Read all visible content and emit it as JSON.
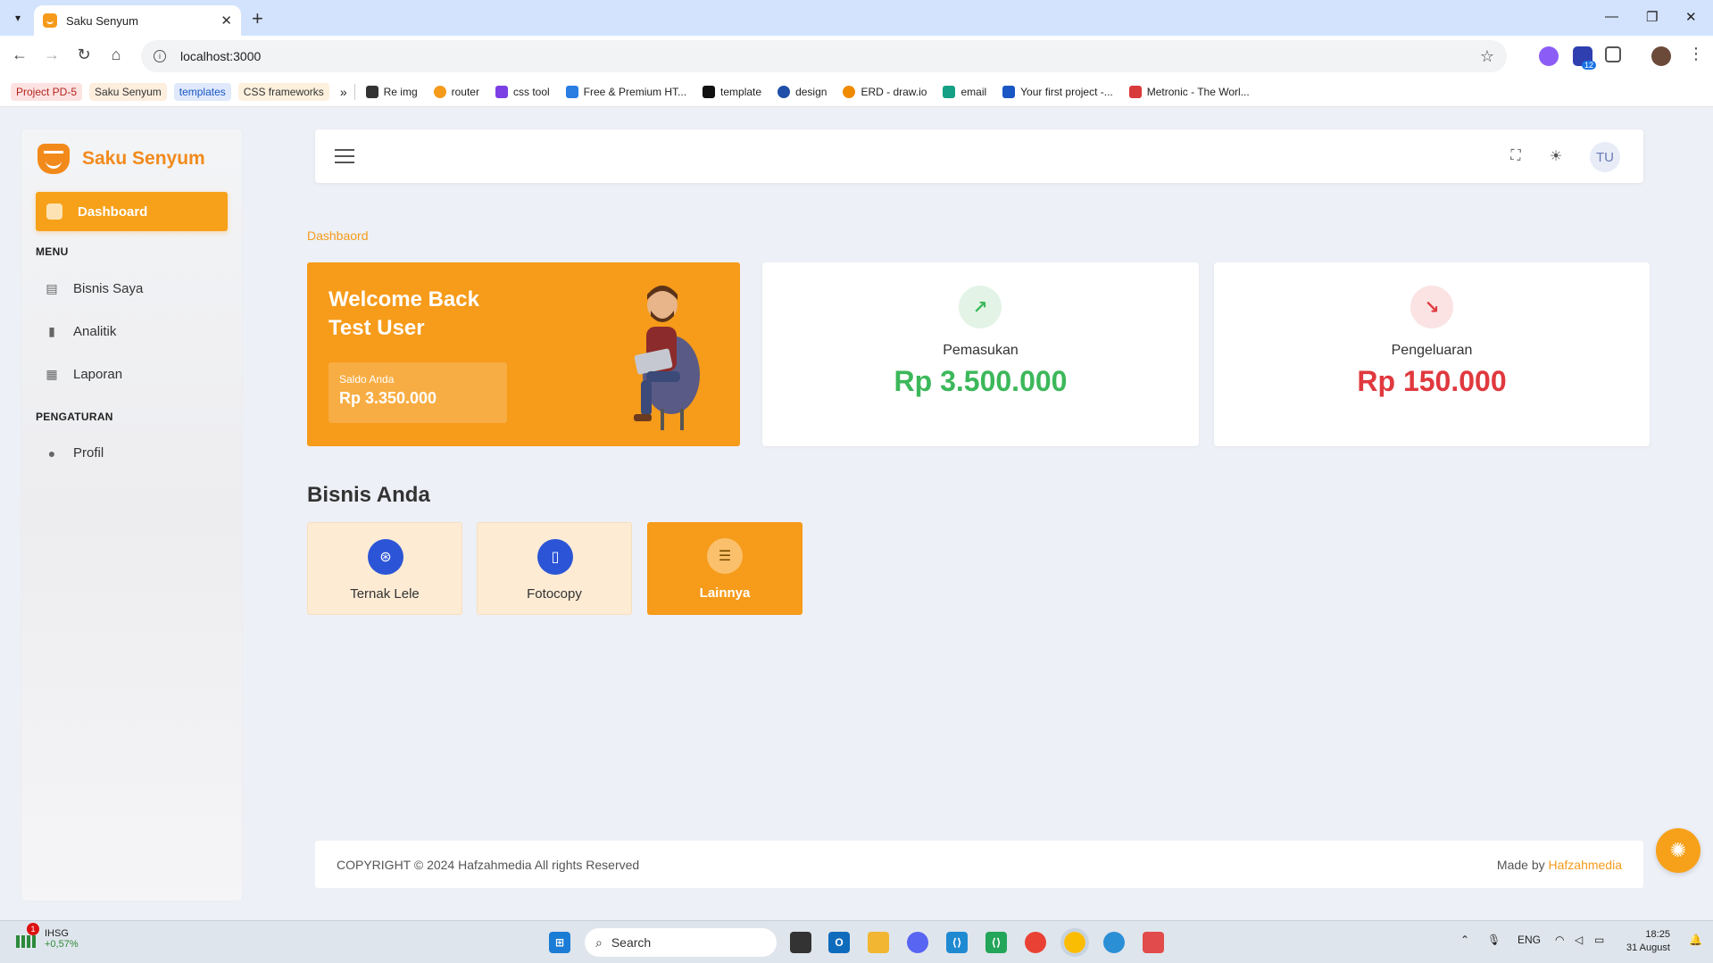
{
  "browser": {
    "tab_title": "Saku Senyum",
    "url": "localhost:3000",
    "bookmarks_chips": [
      "Project PD-5",
      "Saku Senyum",
      "templates",
      "CSS frameworks"
    ],
    "bookmarks_more": "»",
    "bookmarks": [
      "Re img",
      "router",
      "css tool",
      "Free & Premium HT...",
      "template",
      "design",
      "ERD - draw.io",
      "email",
      "Your first project -...",
      "Metronic - The Worl..."
    ],
    "extension_badge": "12"
  },
  "app": {
    "brand": "Saku Senyum",
    "nav_active": "Dashboard",
    "menu_section": "MENU",
    "menu_items": [
      "Bisnis Saya",
      "Analitik",
      "Laporan"
    ],
    "settings_section": "PENGATURAN",
    "settings_items": [
      "Profil"
    ],
    "avatar_initials": "TU",
    "breadcrumb": "Dashbaord",
    "welcome": {
      "line1": "Welcome Back",
      "line2": "Test User",
      "saldo_label": "Saldo Anda",
      "saldo_value": "Rp 3.350.000"
    },
    "income": {
      "label": "Pemasukan",
      "value": "Rp 3.500.000",
      "color": "#3cb85a"
    },
    "expense": {
      "label": "Pengeluaran",
      "value": "Rp 150.000",
      "color": "#e0393e"
    },
    "business_title": "Bisnis Anda",
    "businesses": [
      "Ternak Lele",
      "Fotocopy",
      "Lainnya"
    ],
    "footer_left": "COPYRIGHT © 2024 Hafzahmedia All rights Reserved",
    "footer_made_by": "Made by",
    "footer_brand": "Hafzahmedia",
    "accent": "#f69b1a"
  },
  "taskbar": {
    "ticker_badge": "1",
    "ticker_name": "IHSG",
    "ticker_value": "+0,57%",
    "search_label": "Search",
    "lang": "ENG",
    "time": "18:25",
    "date": "31 August"
  }
}
